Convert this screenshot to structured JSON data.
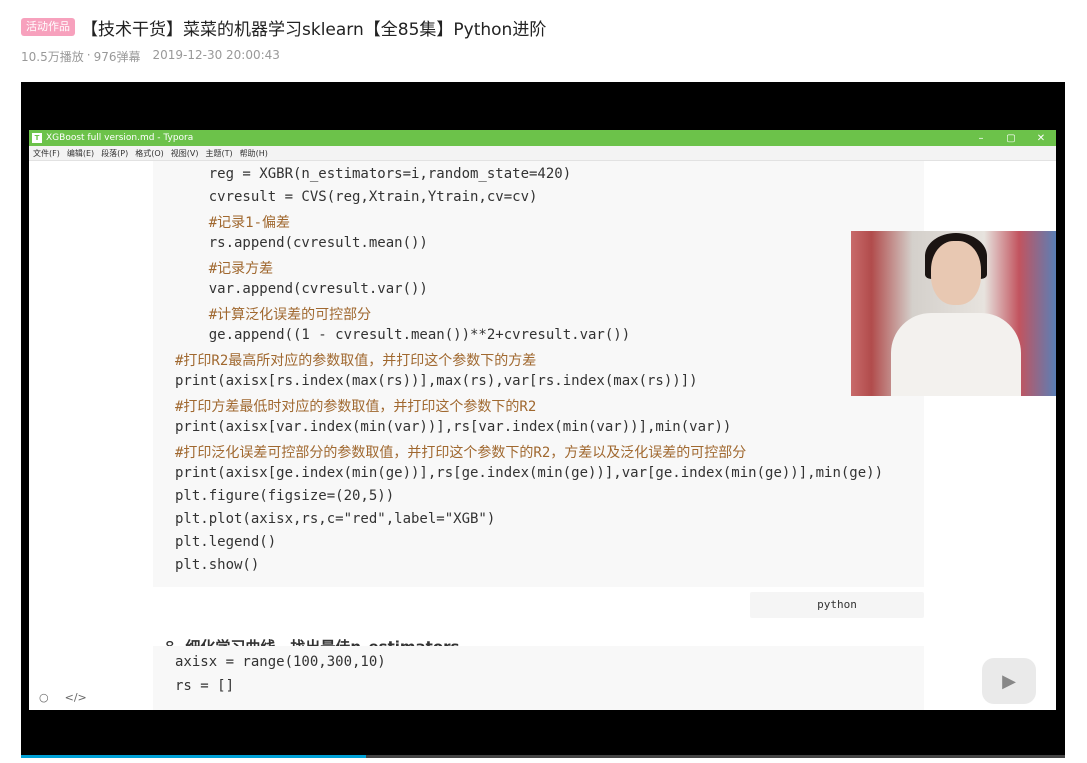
{
  "video": {
    "badge": "活动作品",
    "title": "【技术干货】菜菜的机器学习sklearn【全85集】Python进阶",
    "views": "10.5万播放",
    "separator": "·",
    "danmaku": "976弹幕",
    "date": "2019-12-30 20:00:43",
    "progress": 0.33
  },
  "typora": {
    "window_title": "XGBoost full version.md - Typora",
    "controls": [
      "–",
      "▢",
      "✕"
    ],
    "menu": [
      "文件(F)",
      "编辑(E)",
      "段落(P)",
      "格式(O)",
      "视图(V)",
      "主题(T)",
      "帮助(H)"
    ],
    "code_lines": [
      "    reg = XGBR(n_estimators=i,random_state=420)",
      "    cvresult = CVS(reg,Xtrain,Ytrain,cv=cv)",
      "    #记录1-偏差",
      "    rs.append(cvresult.mean())",
      "    #记录方差",
      "    var.append(cvresult.var())",
      "    #计算泛化误差的可控部分",
      "    ge.append((1 - cvresult.mean())**2+cvresult.var())",
      "#打印R2最高所对应的参数取值，并打印这个参数下的方差",
      "print(axisx[rs.index(max(rs))],max(rs),var[rs.index(max(rs))])",
      "#打印方差最低时对应的参数取值，并打印这个参数下的R2",
      "print(axisx[var.index(min(var))],rs[var.index(min(var))],min(var))",
      "#打印泛化误差可控部分的参数取值，并打印这个参数下的R2，方差以及泛化误差的可控部分",
      "print(axisx[ge.index(min(ge))],rs[ge.index(min(ge))],var[ge.index(min(ge))],min(ge))",
      "plt.figure(figsize=(20,5))",
      "plt.plot(axisx,rs,c=\"red\",label=\"XGB\")",
      "plt.legend()",
      "plt.show()"
    ],
    "language_label": "python",
    "heading_number": "8.",
    "heading_text": "细化学习曲线，找出最佳n_estimators",
    "code2_lines": [
      "axisx = range(100,300,10)",
      "rs = []"
    ],
    "bottom_icons": [
      "○",
      "</>"
    ],
    "watermark_icon": "play-logo-icon"
  },
  "colors": {
    "titlebar": "#6cc24a",
    "comment": "#a0682f",
    "keyword": "#3a4fb0",
    "string": "#b02a2a",
    "badge": "#f7a1bd"
  }
}
